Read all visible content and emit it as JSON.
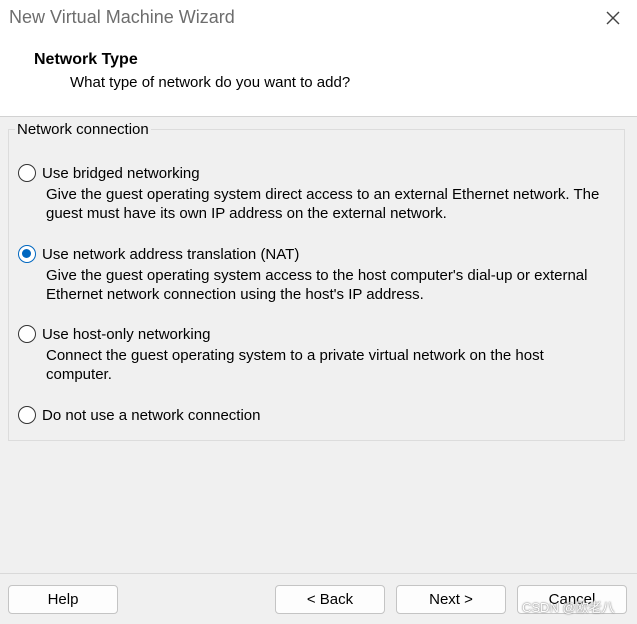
{
  "window": {
    "title": "New Virtual Machine Wizard",
    "close_symbol": "✕"
  },
  "header": {
    "title": "Network Type",
    "subtitle": "What type of network do you want to add?"
  },
  "network": {
    "group_label": "Network connection",
    "selected": "nat",
    "options": [
      {
        "id": "bridged",
        "label": "Use bridged networking",
        "description": "Give the guest operating system direct access to an external Ethernet network. The guest must have its own IP address on the external network."
      },
      {
        "id": "nat",
        "label": "Use network address translation (NAT)",
        "description": "Give the guest operating system access to the host computer's dial-up or external Ethernet network connection using the host's IP address."
      },
      {
        "id": "host_only",
        "label": "Use host-only networking",
        "description": "Connect the guest operating system to a private virtual network on the host computer."
      },
      {
        "id": "none",
        "label": "Do not use a network connection",
        "description": ""
      }
    ]
  },
  "buttons": {
    "help": "Help",
    "back": "< Back",
    "next": "Next >",
    "cancel": "Cancel"
  },
  "watermark": "CSDN @欧老八",
  "colors": {
    "accent": "#0067c0",
    "window_bg": "#f0f0f0",
    "header_bg": "#ffffff"
  }
}
